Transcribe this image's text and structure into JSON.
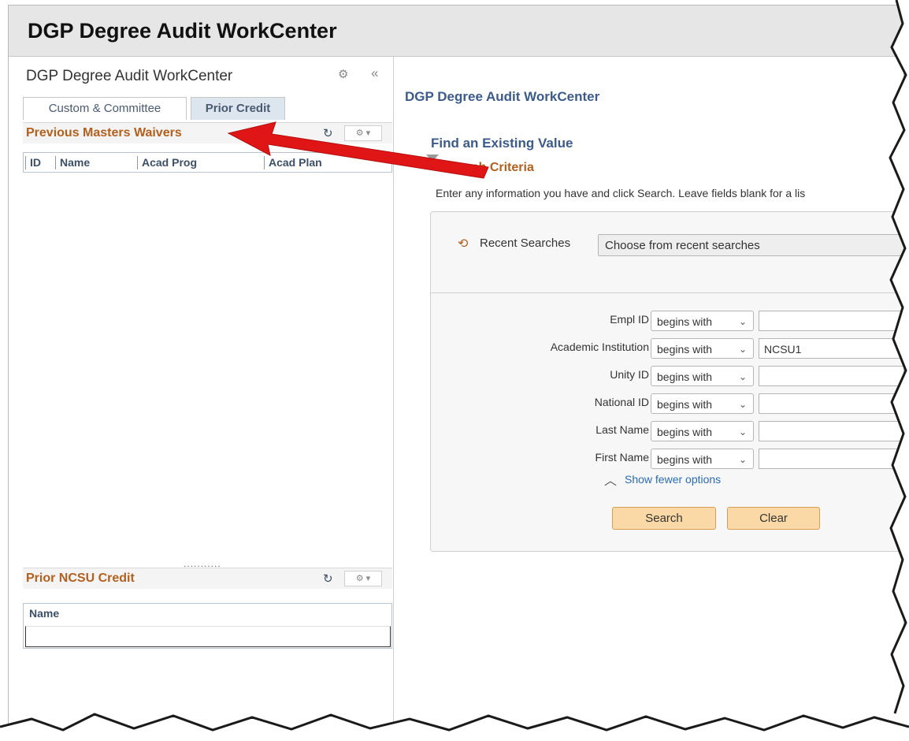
{
  "banner": {
    "title": "DGP Degree Audit WorkCenter"
  },
  "left_pane": {
    "title": "DGP Degree Audit WorkCenter",
    "settings_icon": "gear-icon",
    "collapse_icon": "double-chevron-left-icon",
    "tabs": [
      {
        "label": "Custom & Committee",
        "active": false
      },
      {
        "label": "Prior Credit",
        "active": true
      }
    ],
    "panel1": {
      "title": "Previous Masters Waivers",
      "columns": [
        "ID",
        "Name",
        "Acad Prog",
        "Acad Plan"
      ]
    },
    "grip": "...........",
    "panel2": {
      "title": "Prior NCSU Credit",
      "columns": [
        "Name"
      ]
    }
  },
  "main": {
    "title": "DGP Degree Audit WorkCenter",
    "find_title": "Find an Existing Value",
    "criteria_title": "Search Criteria",
    "instructions": "Enter any information you have and click Search. Leave fields blank for a lis",
    "recent": {
      "label": "Recent Searches",
      "select_value": "Choose from recent searches"
    },
    "fields": [
      {
        "label": "Empl ID",
        "operator": "begins with",
        "value": ""
      },
      {
        "label": "Academic Institution",
        "operator": "begins with",
        "value": "NCSU1"
      },
      {
        "label": "Unity ID",
        "operator": "begins with",
        "value": ""
      },
      {
        "label": "National ID",
        "operator": "begins with",
        "value": ""
      },
      {
        "label": "Last Name",
        "operator": "begins with",
        "value": ""
      },
      {
        "label": "First Name",
        "operator": "begins with",
        "value": ""
      }
    ],
    "show_fewer": "Show fewer options",
    "search_button": "Search",
    "clear_button": "Clear"
  },
  "colors": {
    "accent_orange": "#b3601e",
    "heading_blue": "#3c5a8a",
    "arrow_red": "#e01616",
    "button_bg": "#fbd9a6"
  }
}
